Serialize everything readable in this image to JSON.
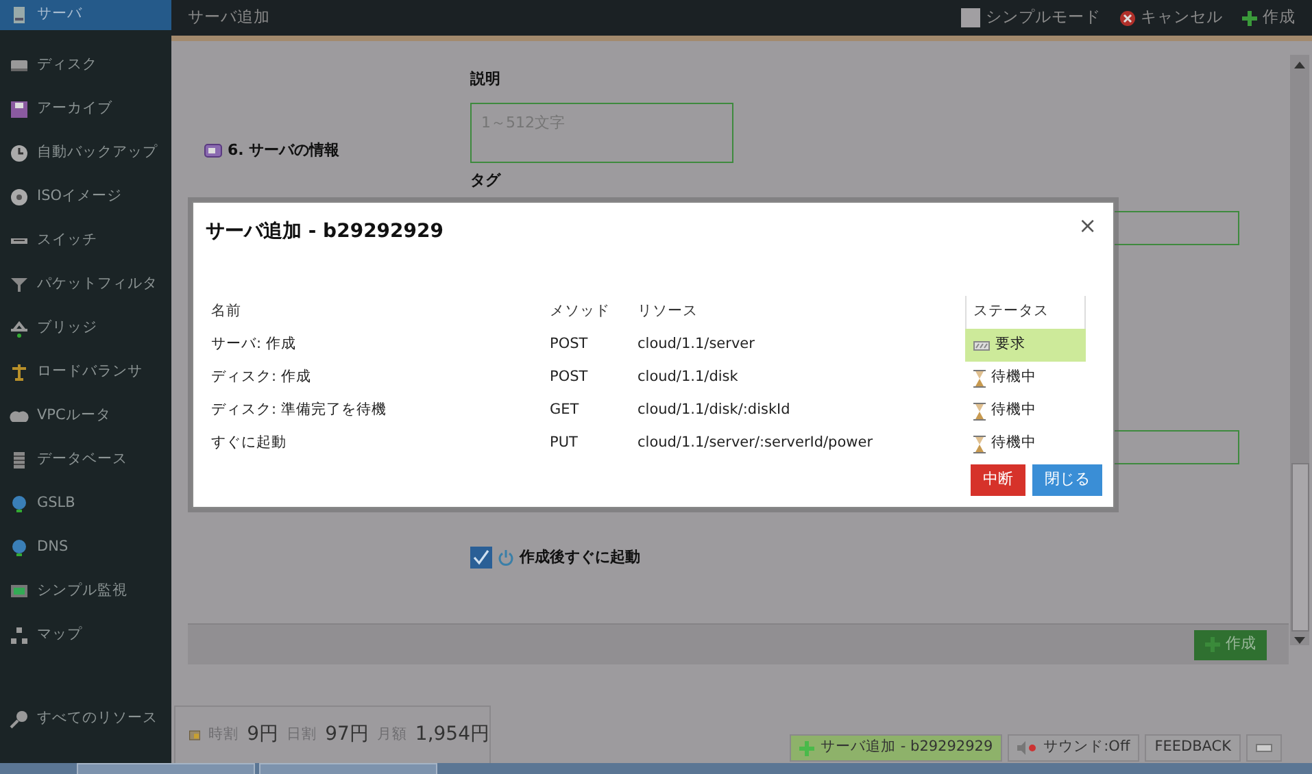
{
  "sidebar": {
    "items": [
      {
        "label": "サーバ",
        "selected": true
      },
      {
        "label": "ディスク",
        "selected": false
      },
      {
        "label": "アーカイブ",
        "selected": false
      },
      {
        "label": "自動バックアップ",
        "selected": false
      },
      {
        "label": "ISOイメージ",
        "selected": false
      },
      {
        "label": "スイッチ",
        "selected": false
      },
      {
        "label": "パケットフィルタ",
        "selected": false
      },
      {
        "label": "ブリッジ",
        "selected": false
      },
      {
        "label": "ロードバランサ",
        "selected": false
      },
      {
        "label": "VPCルータ",
        "selected": false
      },
      {
        "label": "データベース",
        "selected": false
      },
      {
        "label": "GSLB",
        "selected": false
      },
      {
        "label": "DNS",
        "selected": false
      },
      {
        "label": "シンプル監視",
        "selected": false
      },
      {
        "label": "マップ",
        "selected": false
      }
    ],
    "footer_item": "すべてのリソース"
  },
  "header": {
    "title": "サーバ追加",
    "actions": [
      {
        "kind": "toggle",
        "label": "シンプルモード",
        "checked": false
      },
      {
        "kind": "cancel",
        "label": "キャンセル"
      },
      {
        "kind": "create",
        "label": "作成"
      }
    ]
  },
  "form": {
    "section_heading": "6. サーバの情報",
    "description": {
      "label": "説明",
      "placeholder": "1～512文字"
    },
    "tag_label": "タグ",
    "boot_option": {
      "label": "作成後すぐに起動",
      "checked": true
    },
    "submit_button": "作成"
  },
  "pricing": [
    {
      "label": "時割",
      "value": "9円"
    },
    {
      "label": "日割",
      "value": "97円"
    },
    {
      "label": "月額",
      "value": "1,954円"
    }
  ],
  "dialog": {
    "title": "サーバ追加 - b29292929",
    "close": "×",
    "columns": [
      "名前",
      "メソッド",
      "リソース",
      "ステータス"
    ],
    "rows": [
      {
        "name": "サーバ: 作成",
        "method": "POST",
        "resource": "cloud/1.1/server",
        "status": {
          "kind": "request",
          "label": "要求"
        }
      },
      {
        "name": "ディスク: 作成",
        "method": "POST",
        "resource": "cloud/1.1/disk",
        "status": {
          "kind": "waiting",
          "label": "待機中"
        }
      },
      {
        "name": "ディスク: 準備完了を待機",
        "method": "GET",
        "resource": "cloud/1.1/disk/:diskId",
        "status": {
          "kind": "waiting",
          "label": "待機中"
        }
      },
      {
        "name": "すぐに起動",
        "method": "PUT",
        "resource": "cloud/1.1/server/:serverId/power",
        "status": {
          "kind": "waiting",
          "label": "待機中"
        }
      }
    ],
    "buttons": [
      {
        "kind": "abort",
        "label": "中断"
      },
      {
        "kind": "close",
        "label": "閉じる"
      }
    ]
  },
  "status_bar": {
    "task": "サーバ追加 - b29292929",
    "sound": "サウンド:Off",
    "feedback": "FEEDBACK"
  }
}
